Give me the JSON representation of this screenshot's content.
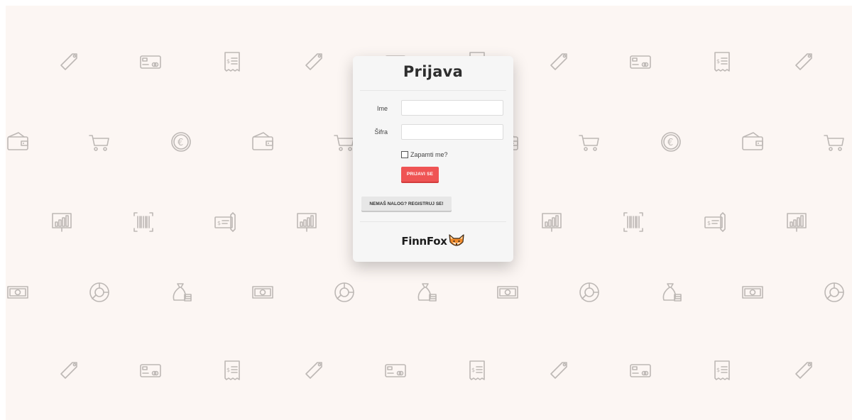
{
  "login": {
    "title": "Prijava",
    "username_label": "Ime",
    "password_label": "Šifra",
    "username_value": "",
    "password_value": "",
    "remember_label": "Zapamti me?",
    "remember_checked": false,
    "submit_label": "PRIJAVI SE",
    "register_label": "NEMAŠ NALOG? REGISTRUJ SE!"
  },
  "brand": {
    "name": "FinnFox",
    "logo_icon": "fox-head-icon"
  },
  "background": {
    "color": "#fcf6f3",
    "icon_color": "#bdb8b5",
    "pattern_icons": [
      "price-tag-icon",
      "credit-card-icon",
      "receipt-icon",
      "wallet-icon",
      "shopping-cart-icon",
      "euro-coin-icon",
      "bar-chart-board-icon",
      "barcode-icon",
      "cheque-icon",
      "banknote-icon",
      "pie-chart-icon",
      "money-bag-icon"
    ]
  },
  "colors": {
    "accent": "#ef5454",
    "card": "#f6f6f6"
  }
}
